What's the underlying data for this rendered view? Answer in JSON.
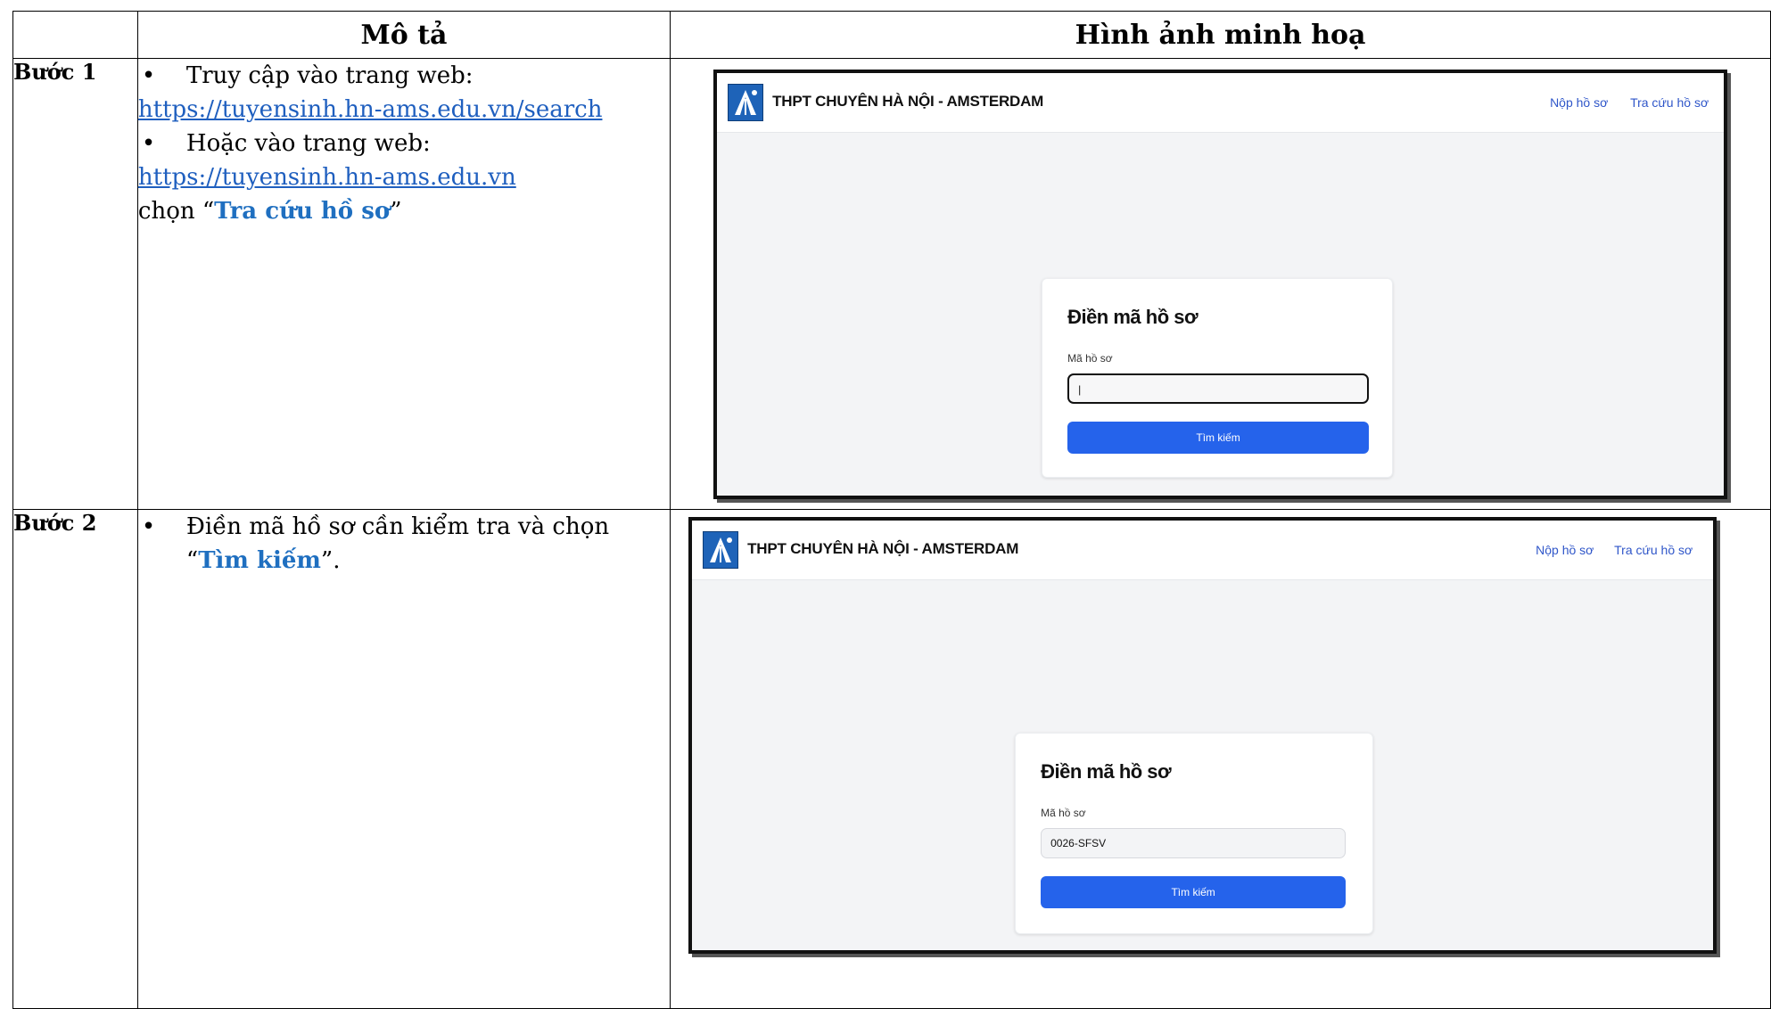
{
  "headers": {
    "col2": "Mô tả",
    "col3": "Hình ảnh minh hoạ"
  },
  "steps": [
    {
      "label": "Bước 1",
      "bullet1": "Truy cập vào trang web:",
      "link1": "https://tuyensinh.hn-ams.edu.vn/search",
      "bullet2": "Hoặc vào trang web:",
      "link2": "https://tuyensinh.hn-ams.edu.vn",
      "choose_prefix": "chọn “",
      "choose_highlight": "Tra cứu hồ sơ",
      "choose_suffix": "”"
    },
    {
      "label": "Bước 2",
      "text": "Điền mã hồ sơ cần kiểm tra và chọn",
      "quote_open": "“",
      "highlight": "Tìm kiếm",
      "quote_close": "”."
    }
  ],
  "app": {
    "brand": "THPT CHUYÊN HÀ NỘI - AMSTERDAM",
    "nav_submit": "Nộp hồ sơ",
    "nav_lookup": "Tra cứu hồ sơ",
    "card_title": "Điền mã hồ sơ",
    "field_label": "Mã hồ sơ",
    "search_button": "Tìm kiếm"
  },
  "screenshots": [
    {
      "input_value": "|"
    },
    {
      "input_value": "0026-SFSV"
    }
  ],
  "colors": {
    "link": "#1f5fbf",
    "highlight": "#1f6fc0",
    "button": "#2563eb",
    "nav": "#2f56c9"
  },
  "icons": [
    "school-logo-icon",
    "bullet-icon"
  ]
}
